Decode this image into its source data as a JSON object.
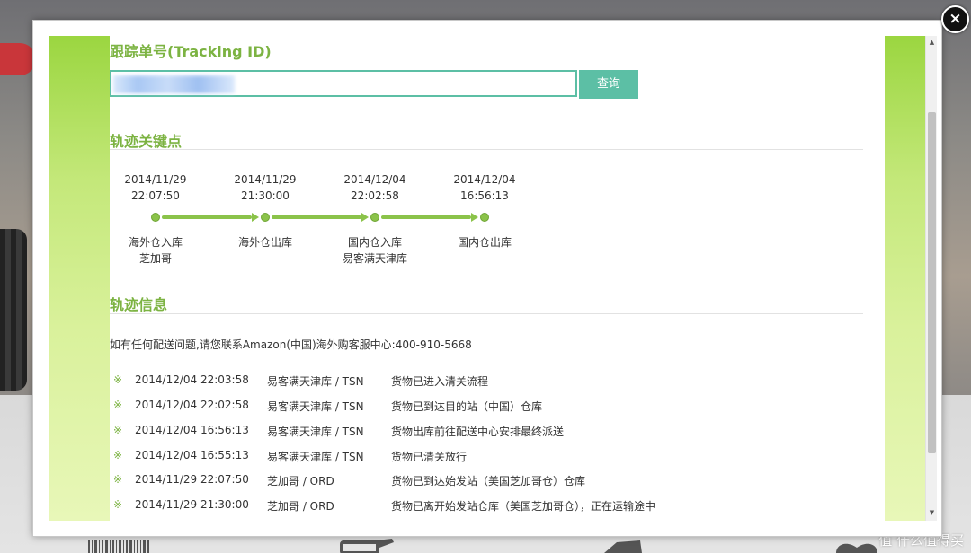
{
  "modal": {
    "close_label": "×",
    "tracking": {
      "heading": "跟踪单号(Tracking ID)",
      "input_value": "",
      "query_label": "查询"
    },
    "milestones_heading": "轨迹关键点",
    "milestones": [
      {
        "date": "2014/11/29",
        "time": "22:07:50",
        "status": "海外仓入库",
        "location": "芝加哥"
      },
      {
        "date": "2014/11/29",
        "time": "21:30:00",
        "status": "海外仓出库",
        "location": ""
      },
      {
        "date": "2014/12/04",
        "time": "22:02:58",
        "status": "国内仓入库",
        "location": "易客满天津库"
      },
      {
        "date": "2014/12/04",
        "time": "16:56:13",
        "status": "国内仓出库",
        "location": ""
      }
    ],
    "info_heading": "轨迹信息",
    "contact_note": "如有任何配送问题,请您联系Amazon(中国)海外购客服中心:400-910-5668",
    "event_marker": "※",
    "events": [
      {
        "time": "2014/12/04 22:03:58",
        "location": "易客满天津库 / TSN",
        "description": "货物已进入清关流程"
      },
      {
        "time": "2014/12/04 22:02:58",
        "location": "易客满天津库 / TSN",
        "description": "货物已到达目的站（中国）仓库"
      },
      {
        "time": "2014/12/04 16:56:13",
        "location": "易客满天津库 / TSN",
        "description": "货物出库前往配送中心安排最终派送"
      },
      {
        "time": "2014/12/04 16:55:13",
        "location": "易客满天津库 / TSN",
        "description": "货物已清关放行"
      },
      {
        "time": "2014/11/29 22:07:50",
        "location": "芝加哥 / ORD",
        "description": "货物已到达始发站（美国芝加哥仓）仓库"
      },
      {
        "time": "2014/11/29 21:30:00",
        "location": "芝加哥 / ORD",
        "description": "货物已离开始发站仓库（美国芝加哥仓），正在运输途中"
      }
    ]
  },
  "watermark": "值 什么值得买",
  "colors": {
    "accent_green": "#7cb342",
    "button_teal": "#5cbfa5",
    "milestone_green": "#8bc34a"
  }
}
